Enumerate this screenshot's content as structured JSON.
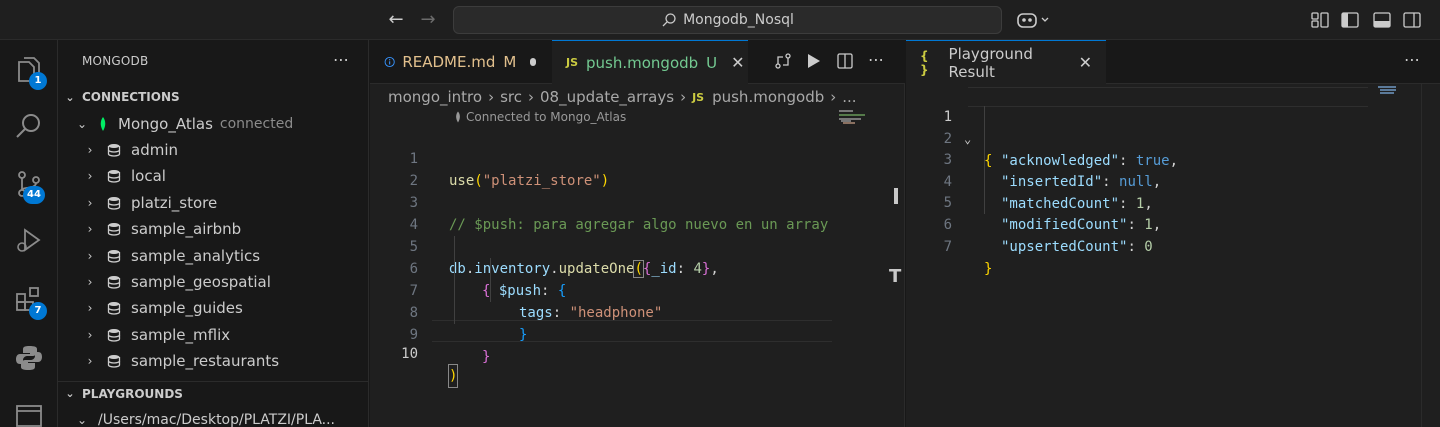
{
  "titlebar": {
    "search_text": "Mongodb_Nosql"
  },
  "activity": {
    "explorer_badge": "1",
    "scm_badge": "44",
    "extensions_badge": "7"
  },
  "sidebar": {
    "title": "MONGODB",
    "connections_label": "CONNECTIONS",
    "connection_name": "Mongo_Atlas",
    "connection_status": "connected",
    "databases": [
      "admin",
      "local",
      "platzi_store",
      "sample_airbnb",
      "sample_analytics",
      "sample_geospatial",
      "sample_guides",
      "sample_mflix",
      "sample_restaurants"
    ],
    "playgrounds_label": "PLAYGROUNDS",
    "playground_path": "/Users/mac/Desktop/PLATZI/PLA..."
  },
  "editor1": {
    "tabs": [
      {
        "label": "README.md",
        "status": "M"
      },
      {
        "label": "push.mongodb",
        "status": "U"
      }
    ],
    "breadcrumb": [
      "mongo_intro",
      "src",
      "08_update_arrays",
      "push.mongodb",
      "..."
    ],
    "codelens": "Connected to Mongo_Atlas",
    "line_numbers": [
      "1",
      "2",
      "3",
      "4",
      "5",
      "6",
      "7",
      "8",
      "9",
      "10"
    ],
    "code": {
      "l1_fn": "use",
      "l1_open": "(",
      "l1_str": "\"platzi_store\"",
      "l1_close": ")",
      "l3_comment": "// $push: para agregar algo nuevo en un array",
      "l5_db": "db",
      "l5_dot1": ".",
      "l5_coll": "inventory",
      "l5_dot2": ".",
      "l5_fn": "updateOne",
      "l5_paren": "(",
      "l5_brace": "{",
      "l5_key": "_id",
      "l5_colon": ": ",
      "l5_num": "4",
      "l5_close": "}",
      "l5_comma": ",",
      "l6_brace": "{",
      "l6_key": " $push",
      "l6_colon": ": ",
      "l6_brace2": "{",
      "l7_key": "tags",
      "l7_colon": ": ",
      "l7_str": "\"headphone\"",
      "l8_close": "}",
      "l9_close": "}",
      "l10_close": ")"
    }
  },
  "editor2": {
    "tab_label": "Playground Result",
    "line_numbers": [
      "1",
      "2",
      "3",
      "4",
      "5",
      "6",
      "7"
    ],
    "result": {
      "open": "{",
      "close": "}",
      "rows": [
        {
          "key": "\"acknowledged\"",
          "value": "true",
          "comma": ","
        },
        {
          "key": "\"insertedId\"",
          "value": "null",
          "comma": ","
        },
        {
          "key": "\"matchedCount\"",
          "value": "1",
          "comma": ","
        },
        {
          "key": "\"modifiedCount\"",
          "value": "1",
          "comma": ","
        },
        {
          "key": "\"upsertedCount\"",
          "value": "0",
          "comma": ""
        }
      ]
    }
  }
}
